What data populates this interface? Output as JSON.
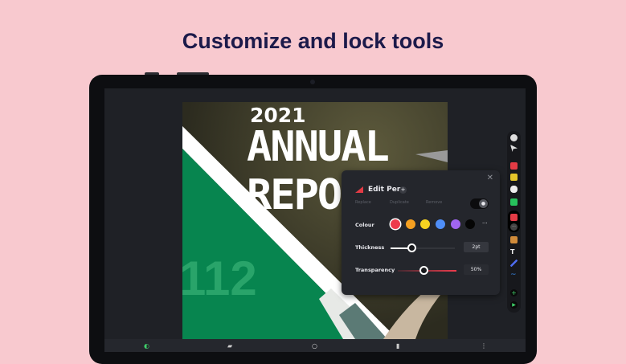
{
  "headline": "Customize and lock tools",
  "document": {
    "year": "2021",
    "title_line1": "ANNUAL",
    "title_line2": "REPO",
    "number": "112"
  },
  "toolbar": {
    "tools": [
      "hand-icon",
      "pointer-icon",
      "pen-red-icon",
      "highlighter-icon",
      "eraser-icon",
      "text-box-icon",
      "active-pen-icon",
      "more-icon",
      "stamp-icon",
      "text-icon",
      "pen-blue-icon",
      "squiggle-icon",
      "add-icon",
      "record-icon"
    ]
  },
  "panel": {
    "title": "Edit Pen",
    "add": "+",
    "close": "✕",
    "actions": [
      "Replace",
      "Duplicate",
      "Remove"
    ],
    "lock_icon": "🔒",
    "colour_label": "Colour",
    "colours": [
      "#ee3b4c",
      "#f5a021",
      "#f7d321",
      "#4f8ef7",
      "#a065f0",
      "#050505"
    ],
    "more": "···",
    "thickness_label": "Thickness",
    "thickness_value": "2pt",
    "thickness_fraction": 0.25,
    "transparency_label": "Transparency",
    "transparency_value": "50%",
    "transparency_fraction": 0.5,
    "accent": "#ee3b4c"
  },
  "bottombar": {
    "icons": [
      "tools-icon",
      "folder-add-icon",
      "search-icon",
      "page-icon",
      "more-vertical-icon"
    ]
  }
}
